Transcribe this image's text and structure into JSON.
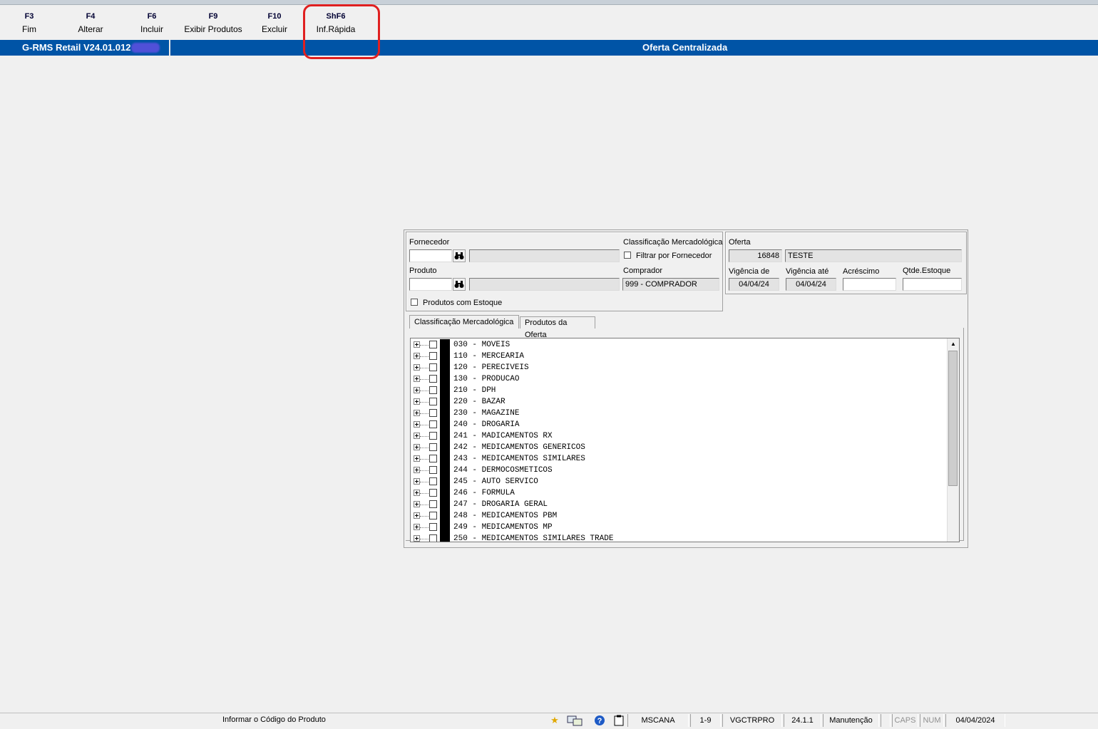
{
  "toolbar": {
    "keys": [
      {
        "key": "F3",
        "label": "Fim"
      },
      {
        "key": "F4",
        "label": "Alterar"
      },
      {
        "key": "F6",
        "label": "Incluir"
      },
      {
        "key": "F9",
        "label": "Exibir Produtos"
      },
      {
        "key": "F10",
        "label": "Excluir"
      },
      {
        "key": "ShF6",
        "label": "Inf.Rápida"
      }
    ]
  },
  "titlebar": {
    "app_version": "G-RMS Retail V24.01.012",
    "screen_title": "Oferta Centralizada"
  },
  "form": {
    "fornecedor_label": "Fornecedor",
    "fornecedor_code": "",
    "fornecedor_name": "",
    "produto_label": "Produto",
    "produto_code": "",
    "produto_name": "",
    "produtos_estoque_label": "Produtos com Estoque",
    "classificacao_label": "Classificação Mercadológica",
    "filtrar_label": "Filtrar por Fornecedor",
    "comprador_label": "Comprador",
    "comprador_value": "999 - COMPRADOR",
    "oferta_label": "Oferta",
    "oferta_number": "16848",
    "oferta_desc": "TESTE",
    "vigencia_de_label": "Vigência de",
    "vigencia_de_value": "04/04/24",
    "vigencia_ate_label": "Vigência até",
    "vigencia_ate_value": "04/04/24",
    "acrescimo_label": "Acréscimo",
    "acrescimo_value": "",
    "qtde_label": "Qtde.Estoque",
    "qtde_value": ""
  },
  "tabs": {
    "classificacao": "Classificação Mercadológica",
    "produtos_oferta": "Produtos da Oferta"
  },
  "tree_items": [
    "030 - MOVEIS",
    "110 - MERCEARIA",
    "120 - PERECIVEIS",
    "130 - PRODUCAO",
    "210 - DPH",
    "220 - BAZAR",
    "230 - MAGAZINE",
    "240 - DROGARIA",
    "241 - MADICAMENTOS RX",
    "242 - MEDICAMENTOS GENERICOS",
    "243 - MEDICAMENTOS SIMILARES",
    "244 - DERMOCOSMETICOS",
    "245 - AUTO SERVICO",
    "246 - FORMULA",
    "247 - DROGARIA GERAL",
    "248 - MEDICAMENTOS PBM",
    "249 - MEDICAMENTOS MP",
    "250 - MEDICAMENTOS SIMILARES TRADE"
  ],
  "statusbar": {
    "message": "Informar o Código do Produto",
    "user": "MSCANA",
    "range": "1-9",
    "program": "VGCTRPRO",
    "version": "24.1.1",
    "mode": "Manutenção",
    "caps": "CAPS",
    "num": "NUM",
    "date": "04/04/2024"
  },
  "colors": {
    "titlebar": "#0054a6",
    "callout": "#e02020",
    "background": "#f0f0f0"
  },
  "icons": {
    "search": "binoculars-icon",
    "favorite": "star-icon",
    "help": "help-icon",
    "clipboard": "clipboard-icon"
  }
}
